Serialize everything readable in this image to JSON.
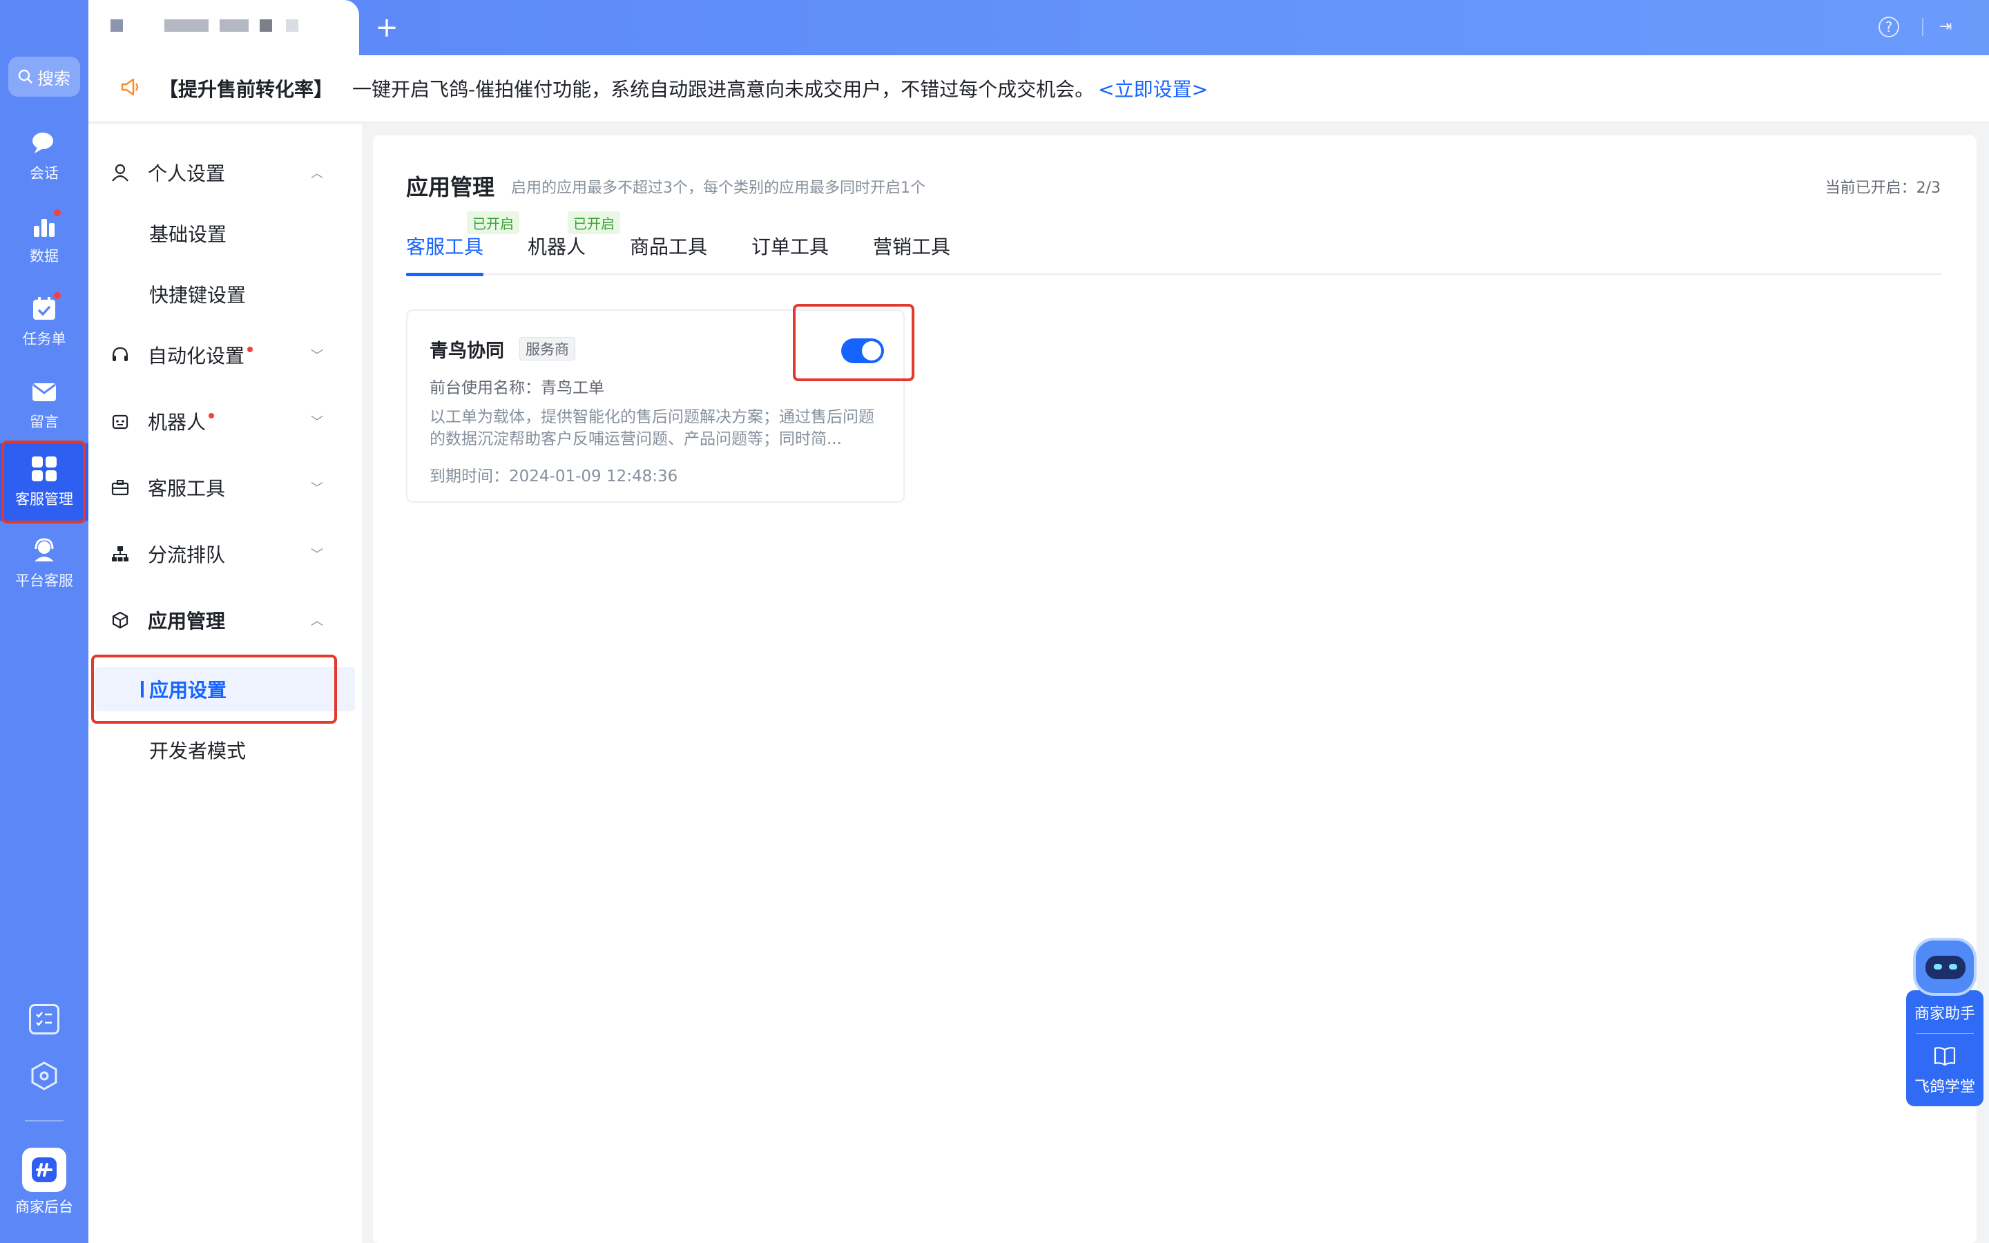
{
  "rail": {
    "search_label": "搜索",
    "items": [
      {
        "label": "会话",
        "icon": "chat-bubbles-icon",
        "has_dot": false
      },
      {
        "label": "数据",
        "icon": "bar-chart-icon",
        "has_dot": true
      },
      {
        "label": "任务单",
        "icon": "calendar-check-icon",
        "has_dot": true
      },
      {
        "label": "留言",
        "icon": "envelope-icon",
        "has_dot": false
      },
      {
        "label": "客服管理",
        "icon": "grid-apps-icon",
        "has_dot": false,
        "active": true
      },
      {
        "label": "平台客服",
        "icon": "headset-agent-icon",
        "has_dot": false
      }
    ],
    "bottom_icons": [
      "checklist-icon",
      "settings-hexagon-icon"
    ],
    "logo_label": "商家后台"
  },
  "topbar": {
    "help_glyph": "?",
    "exit_glyph": "⇥"
  },
  "notice": {
    "title": "【提升售前转化率】",
    "text": "一键开启飞鸽-催拍催付功能，系统自动跟进高意向未成交用户，不错过每个成交机会。",
    "link": "<立即设置>",
    "icon": "megaphone-icon"
  },
  "sidemenu": {
    "personal": {
      "label": "个人设置",
      "chev": "︿"
    },
    "basic": {
      "label": "基础设置"
    },
    "shortcut": {
      "label": "快捷键设置"
    },
    "automation": {
      "label": "自动化设置",
      "chev": "﹀"
    },
    "robot": {
      "label": "机器人",
      "chev": "﹀"
    },
    "cs_tools": {
      "label": "客服工具",
      "chev": "﹀"
    },
    "routing": {
      "label": "分流排队",
      "chev": "﹀"
    },
    "app_mgmt": {
      "label": "应用管理",
      "chev": "︿"
    },
    "app_settings": {
      "label": "应用设置"
    },
    "developer": {
      "label": "开发者模式"
    }
  },
  "main": {
    "title": "应用管理",
    "description": "启用的应用最多不超过3个，每个类别的应用最多同时开启1个",
    "count": "当前已开启：2/3",
    "tabs": [
      {
        "label": "客服工具",
        "badge": "已开启",
        "active": true
      },
      {
        "label": "机器人",
        "badge": "已开启",
        "active": false
      },
      {
        "label": "商品工具",
        "badge": "",
        "active": false
      },
      {
        "label": "订单工具",
        "badge": "",
        "active": false
      },
      {
        "label": "营销工具",
        "badge": "",
        "active": false
      }
    ],
    "app_card": {
      "name": "青鸟协同",
      "tag": "服务商",
      "alias": "前台使用名称：青鸟工单",
      "description": "以工单为载体，提供智能化的售后问题解决方案；通过售后问题的数据沉淀帮助客户反哺运营问题、产品问题等；同时简...",
      "expire": "到期时间：2024-01-09 12:48:36",
      "enabled": true
    }
  },
  "helper": {
    "assistant_label": "商家助手",
    "academy_label": "飞鸽学堂"
  },
  "colors": {
    "rail": "#5b87f7",
    "accent": "#1664ff",
    "highlight_frame": "#e3392d",
    "badge_green": "#3fa03a"
  }
}
